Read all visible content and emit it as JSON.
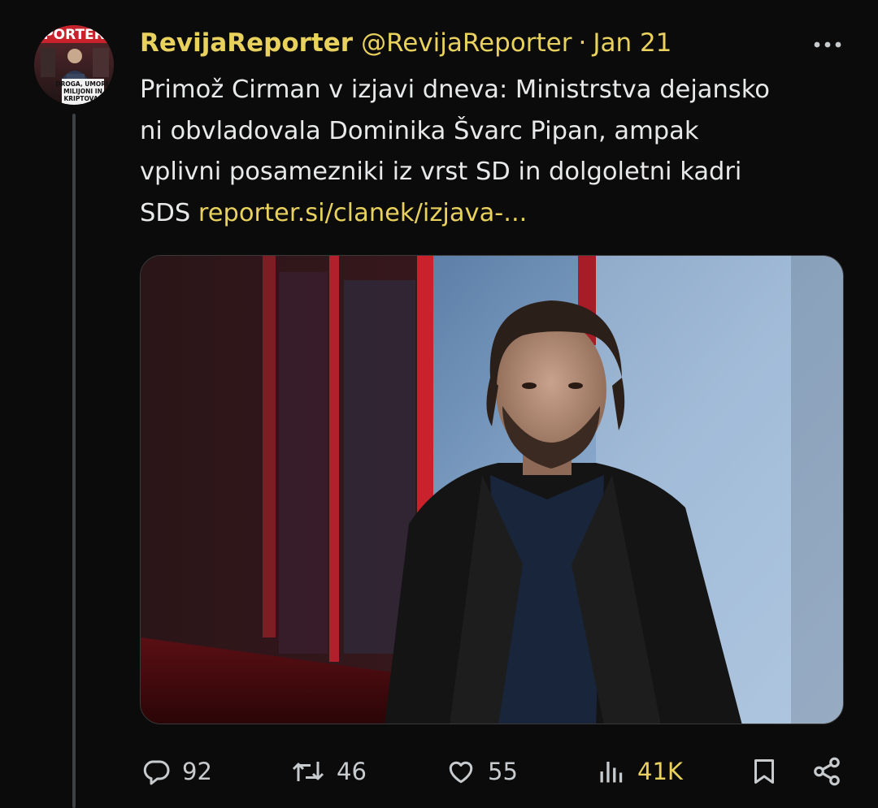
{
  "tweet": {
    "display_name": "RevijaReporter",
    "handle": "@RevijaReporter",
    "separator": "·",
    "date": "Jan 21",
    "text_lines": [
      "Primož Cirman v izjavi dneva: Ministrstva dejansko",
      "ni obvladovala Dominika Švarc Pipan, ampak",
      "vplivni posamezniki iz vrst SD in dolgoletni kadri"
    ],
    "text_last_prefix": "SDS ",
    "link_text": "reporter.si/clanek/izjava-...",
    "avatar_cover": {
      "masthead": "PORTER",
      "headline": [
        "DROGA, UMORI,",
        "MILIJONI IN",
        "KRIPTOVAL"
      ]
    }
  },
  "metrics": {
    "replies": "92",
    "reposts": "46",
    "likes": "55",
    "views": "41K"
  },
  "icons": {
    "more": "more-horizontal-icon",
    "reply": "reply-icon",
    "repost": "repost-icon",
    "like": "heart-icon",
    "views": "analytics-icon",
    "bookmark": "bookmark-icon",
    "share": "share-icon"
  },
  "colors": {
    "background": "#0b0b0b",
    "accent": "#e8d15c",
    "text": "#e7e9ea",
    "icon": "#c7cbce"
  }
}
